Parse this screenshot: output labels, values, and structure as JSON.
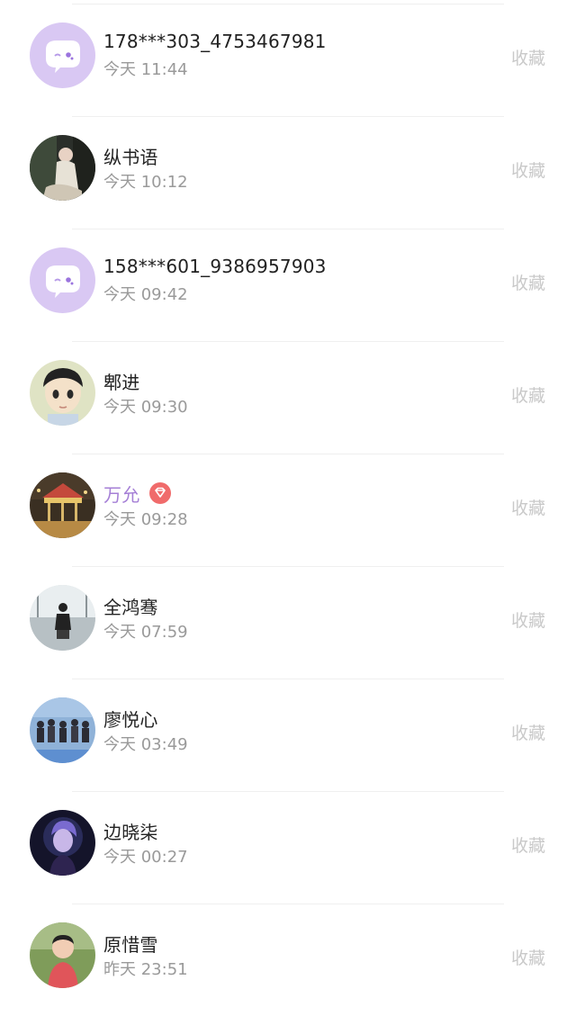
{
  "contacts": [
    {
      "name": "178***303_4753467981",
      "time": "今天 11:44",
      "action": "收藏",
      "avatar": "default-chat-avatar"
    },
    {
      "name": "纵书语",
      "time": "今天 10:12",
      "action": "收藏",
      "avatar": "photo-avatar"
    },
    {
      "name": "158***601_9386957903",
      "time": "今天 09:42",
      "action": "收藏",
      "avatar": "default-chat-avatar"
    },
    {
      "name": "郫进",
      "time": "今天 09:30",
      "action": "收藏",
      "avatar": "cartoon-avatar"
    },
    {
      "name": "万允",
      "time": "今天 09:28",
      "action": "收藏",
      "avatar": "carousel-photo-avatar",
      "vip": true,
      "badge_icon": "diamond-icon"
    },
    {
      "name": "全鸿骞",
      "time": "今天 07:59",
      "action": "收藏",
      "avatar": "silhouette-photo-avatar"
    },
    {
      "name": "廖悦心",
      "time": "今天 03:49",
      "action": "收藏",
      "avatar": "group-photo-avatar"
    },
    {
      "name": "边晓柒",
      "time": "今天 00:27",
      "action": "收藏",
      "avatar": "portrait-photo-avatar"
    },
    {
      "name": "原惜雪",
      "time": "昨天 23:51",
      "action": "收藏",
      "avatar": "child-photo-avatar"
    }
  ],
  "colors": {
    "vip_name": "#a57fd6",
    "default_avatar_bg": "#d9c8f3",
    "badge": "#f06b6b",
    "action_text": "#c9c9c9",
    "time_text": "#9a9a9a"
  }
}
